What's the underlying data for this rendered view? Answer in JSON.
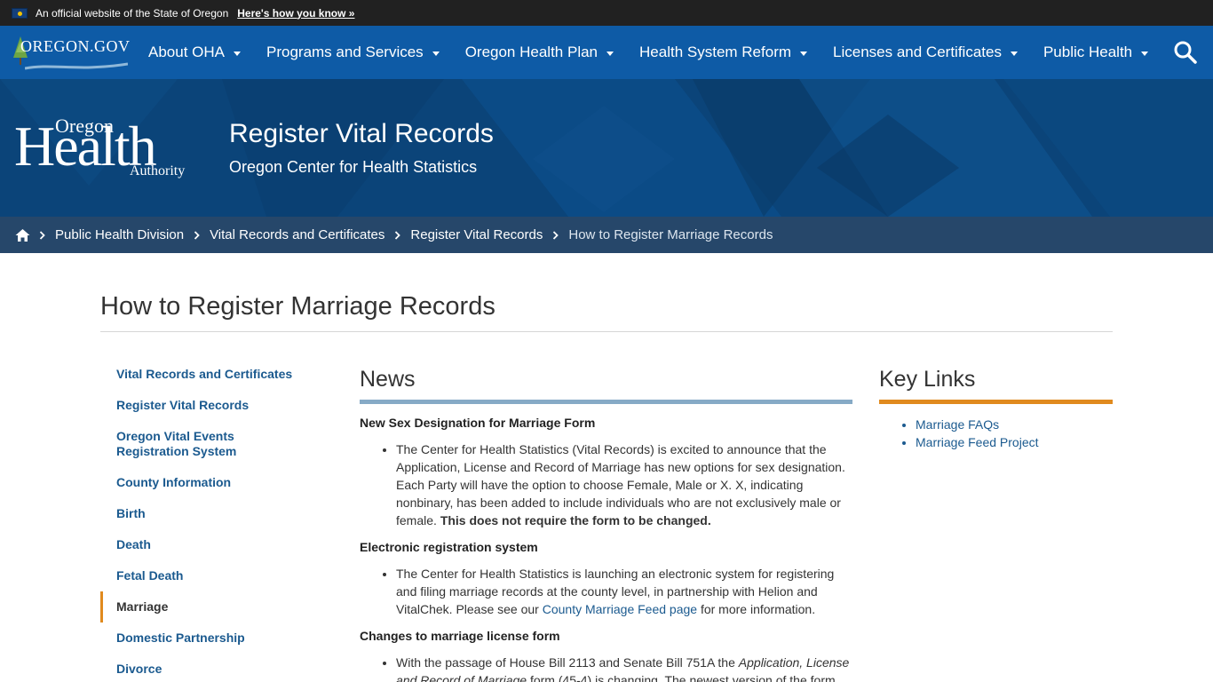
{
  "gov_banner": {
    "official_text": "An official website of the State of Oregon",
    "how_link": "Here's how you know »"
  },
  "topnav": {
    "logo_text": "OREGON.GOV",
    "items": [
      {
        "label": "About OHA"
      },
      {
        "label": "Programs and Services"
      },
      {
        "label": "Oregon Health Plan"
      },
      {
        "label": "Health System Reform"
      },
      {
        "label": "Licenses and Certificates"
      },
      {
        "label": "Public Health"
      }
    ]
  },
  "hero": {
    "logo_oregon": "Oregon",
    "logo_health": "Health",
    "logo_authority": "Authority",
    "title": "Register Vital Records",
    "subtitle": "Oregon Center for Health Statistics"
  },
  "breadcrumb": {
    "items": [
      {
        "label": "Public Health Division"
      },
      {
        "label": "Vital Records and Certificates"
      },
      {
        "label": "Register Vital Records"
      }
    ],
    "current": "How to Register Marriage Records"
  },
  "page": {
    "title": "How to Register Marriage Records"
  },
  "sidenav": {
    "items": [
      {
        "label": "Vital Records and Certificates"
      },
      {
        "label": "Register Vital Records"
      },
      {
        "label": "Oregon Vital Events Registration System"
      },
      {
        "label": "County Information"
      },
      {
        "label": "Birth"
      },
      {
        "label": "Death"
      },
      {
        "label": "Fetal Death"
      },
      {
        "label": "Marriage"
      },
      {
        "label": "Domestic Partnership"
      },
      {
        "label": "Divorce"
      }
    ],
    "active": "Marriage"
  },
  "news": {
    "heading": "News",
    "items": [
      {
        "title": "New Sex Designation for Marriage Form",
        "text": "The Center for Health Statistics (Vital Records) is excited to announce that the Application, License and Record of Marriage has new options for sex designation. Each Party will have the option to choose Female, Male or X.  X, indicating nonbinary, has been added to include individuals who are not exclusively male or female. ",
        "bold": "This does not require the form to be changed."
      },
      {
        "title": "Electronic registration system",
        "text_before": "The Center for Health Statistics is launching an electronic system for registering and filing marriage records at the county level, in partnership with Helion and VitalChek. Please see our ",
        "link": "County Marriage Feed page",
        "text_after": " for more information."
      },
      {
        "title": "Changes to marriage license form",
        "text_before": "With the passage of House Bill 2113 and Senate Bill 751A the ",
        "italic": "Application, License and Record of Marriage",
        "text_after": " form (45-4) is changing. The newest version of the form"
      }
    ]
  },
  "keylinks": {
    "heading": "Key Links",
    "items": [
      {
        "label": "Marriage FAQs"
      },
      {
        "label": "Marriage Feed Project"
      }
    ]
  },
  "colors": {
    "gov_banner": "#212121",
    "nav_blue": "#0e5ba6",
    "hero_blue": "#0b4479",
    "link_blue": "#1b5a8f",
    "accent_orange": "#e08a1e",
    "news_rule": "#86aac6"
  }
}
